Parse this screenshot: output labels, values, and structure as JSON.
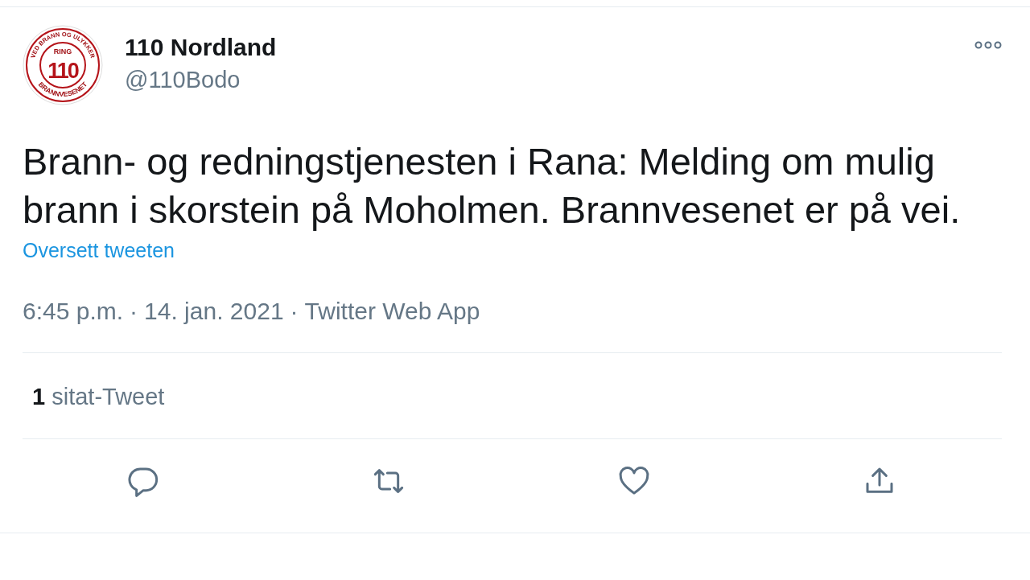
{
  "author": {
    "name": "110 Nordland",
    "handle": "@110Bodo",
    "avatar": {
      "ring_top": "VED BRANN OG ULYKKER",
      "ring_bottom": "BRANNVESENET",
      "small": "RING",
      "big": "110"
    }
  },
  "tweet": {
    "text": "Brann- og redningstjenesten i Rana: Melding om mulig brann i skorstein på Moholmen. Brannvesenet er på vei.",
    "translate_link": "Oversett tweeten",
    "meta": [
      "6:45 p.m.",
      "14. jan. 2021",
      "Twitter Web App"
    ],
    "meta_separator": "·"
  },
  "stats": [
    {
      "count": "1",
      "label": "sitat-Tweet"
    }
  ],
  "actions": [
    {
      "kind": "reply"
    },
    {
      "kind": "retweet"
    },
    {
      "kind": "like"
    },
    {
      "kind": "share"
    }
  ]
}
